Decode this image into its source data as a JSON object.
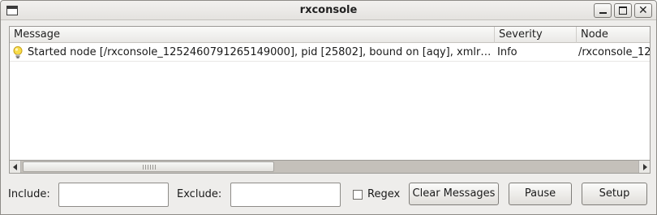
{
  "window": {
    "title": "rxconsole"
  },
  "table": {
    "columns": [
      "Message",
      "Severity",
      "Node"
    ],
    "rows": [
      {
        "icon": "lightbulb-icon",
        "message": "Started node [/rxconsole_1252460791265149000], pid [25802], bound on [aqy], xmlrpc…",
        "severity": "Info",
        "node": "/rxconsole_12"
      }
    ]
  },
  "filters": {
    "include_label": "Include:",
    "include_value": "",
    "exclude_label": "Exclude:",
    "exclude_value": "",
    "regex_label": "Regex",
    "regex_checked": false
  },
  "actions": {
    "clear_label": "Clear Messages",
    "pause_label": "Pause",
    "setup_label": "Setup"
  }
}
